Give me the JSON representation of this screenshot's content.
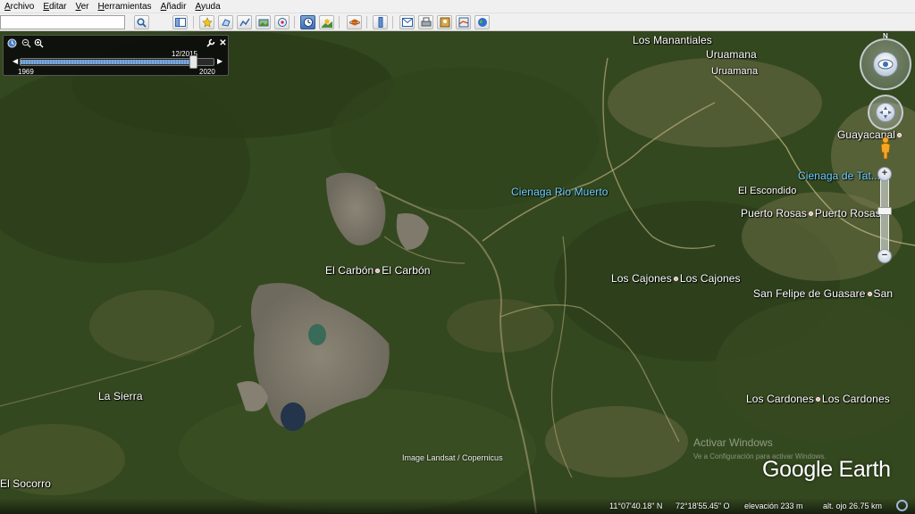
{
  "menu": {
    "items": [
      "Archivo",
      "Editar",
      "Ver",
      "Herramientas",
      "Añadir",
      "Ayuda"
    ]
  },
  "toolbar": {
    "search_value": "",
    "icons": [
      "search-icon",
      "sidebar-icon",
      "placemark-icon",
      "polygon-icon",
      "path-icon",
      "image-overlay-icon",
      "tour-icon",
      "historical-imagery-icon",
      "sunlight-icon",
      "planets-icon",
      "ruler-icon",
      "email-icon",
      "print-icon",
      "save-image-icon",
      "maps-icon"
    ]
  },
  "time_slider": {
    "current_date": "12/2015",
    "start_year": "1969",
    "end_year": "2020",
    "position": 0.9
  },
  "map": {
    "places": [
      {
        "name": "Los Manantiales",
        "type": "town"
      },
      {
        "name": "Uruamana",
        "type": "town"
      },
      {
        "name": "Uruamana",
        "type": "town"
      },
      {
        "name": "Guayacanal",
        "type": "town"
      },
      {
        "name": "Cienaga de Tat...",
        "type": "water"
      },
      {
        "name": "Cienaga Rio Muerto",
        "type": "water"
      },
      {
        "name": "El Escondido",
        "type": "town"
      },
      {
        "name": "Puerto Rosas",
        "type": "town"
      },
      {
        "name": "Puerto Rosas",
        "type": "town"
      },
      {
        "name": "El Carbón",
        "type": "town"
      },
      {
        "name": "El Carbón",
        "type": "town"
      },
      {
        "name": "Los Cajones",
        "type": "town"
      },
      {
        "name": "Los Cajones",
        "type": "town"
      },
      {
        "name": "San Felipe de Guasare",
        "type": "town"
      },
      {
        "name": "San",
        "type": "town"
      },
      {
        "name": "La Sierra",
        "type": "town"
      },
      {
        "name": "Los Cardones",
        "type": "town"
      },
      {
        "name": "Los Cardones",
        "type": "town"
      },
      {
        "name": "El Socorro",
        "type": "town"
      }
    ],
    "compass_north": "N"
  },
  "footer": {
    "imagery_credit": "Image Landsat / Copernicus",
    "watermark_title": "Activar Windows",
    "watermark_sub": "Ve a Configuración para activar Windows.",
    "logo_google": "Google",
    "logo_earth": "Earth",
    "lat": "11°07'40.18\" N",
    "lon": "72°18'55.45\" O",
    "elevation": "elevación   233 m",
    "eye_alt": "alt. ojo  26.75 km"
  },
  "colors": {
    "map_base": "#33461f",
    "water_label": "#6fd3ff",
    "toolbar_active": "#3e6fb5"
  }
}
